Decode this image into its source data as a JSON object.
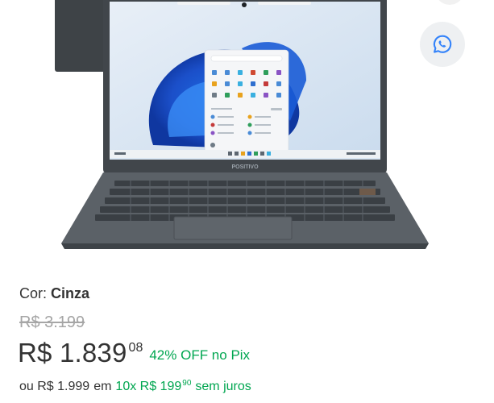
{
  "product": {
    "image_alt": "POSITIVO",
    "color_label": "Cor:",
    "color_value": "Cinza",
    "old_price": "R$ 3.199",
    "price_main": "R$ 1.839",
    "price_cents": "08",
    "discount_text": "42% OFF no Pix",
    "installment_prefix": "ou R$ 1.999",
    "installment_em": "em",
    "installment_count": "10x R$ 199",
    "installment_cents": "90",
    "installment_suffix": "sem juros"
  },
  "icons": {
    "share": "whatsapp-share-icon"
  },
  "colors": {
    "green": "#00a650",
    "text": "#333333",
    "muted": "#a6a6a6"
  }
}
